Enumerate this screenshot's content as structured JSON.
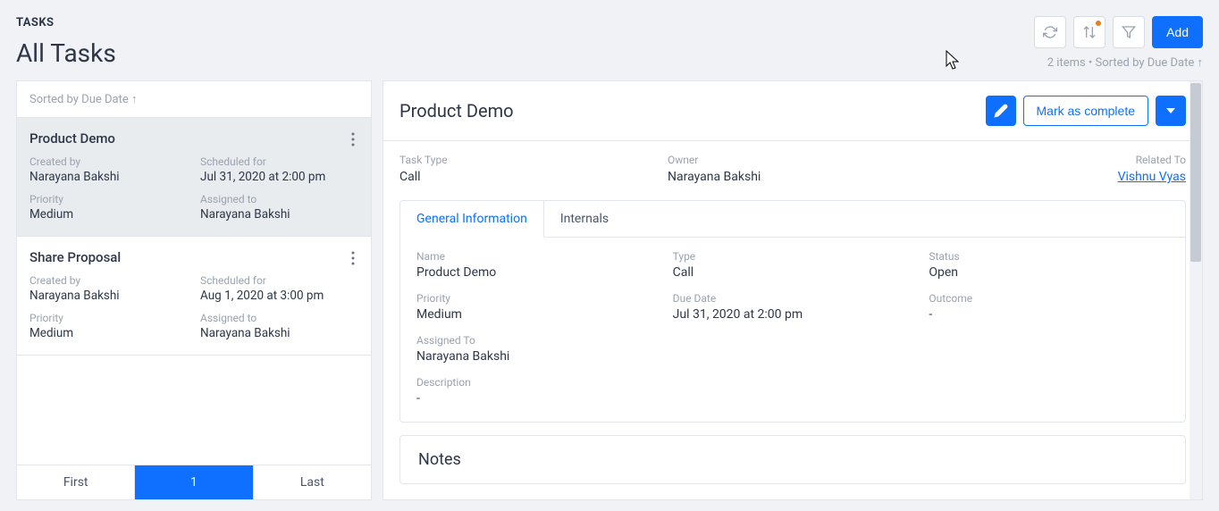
{
  "header": {
    "breadcrumb": "TASKS",
    "title": "All Tasks",
    "add_label": "Add",
    "stats": "2 items • Sorted by Due Date ↑"
  },
  "left": {
    "sort_text": "Sorted by Due Date ↑",
    "tasks": [
      {
        "title": "Product Demo",
        "selected": true,
        "created_by_label": "Created by",
        "created_by": "Narayana Bakshi",
        "scheduled_for_label": "Scheduled for",
        "scheduled_for": "Jul 31, 2020 at 2:00 pm",
        "priority_label": "Priority",
        "priority": "Medium",
        "assigned_to_label": "Assigned to",
        "assigned_to": "Narayana Bakshi"
      },
      {
        "title": "Share Proposal",
        "selected": false,
        "created_by_label": "Created by",
        "created_by": "Narayana Bakshi",
        "scheduled_for_label": "Scheduled for",
        "scheduled_for": "Aug 1, 2020 at 3:00 pm",
        "priority_label": "Priority",
        "priority": "Medium",
        "assigned_to_label": "Assigned to",
        "assigned_to": "Narayana Bakshi"
      }
    ],
    "pagination": {
      "first": "First",
      "page": "1",
      "last": "Last"
    }
  },
  "detail": {
    "title": "Product Demo",
    "mark_complete_label": "Mark as complete",
    "summary": {
      "task_type_label": "Task Type",
      "task_type": "Call",
      "owner_label": "Owner",
      "owner": "Narayana Bakshi",
      "related_to_label": "Related To",
      "related_to": "Vishnu Vyas"
    },
    "tabs": {
      "general": "General Information",
      "internals": "Internals"
    },
    "general": {
      "name_label": "Name",
      "name": "Product Demo",
      "type_label": "Type",
      "type": "Call",
      "status_label": "Status",
      "status": "Open",
      "priority_label": "Priority",
      "priority": "Medium",
      "due_label": "Due Date",
      "due": "Jul 31, 2020 at 2:00 pm",
      "outcome_label": "Outcome",
      "outcome": "-",
      "assigned_label": "Assigned To",
      "assigned": "Narayana Bakshi",
      "desc_label": "Description",
      "desc": "-"
    },
    "notes_label": "Notes"
  }
}
